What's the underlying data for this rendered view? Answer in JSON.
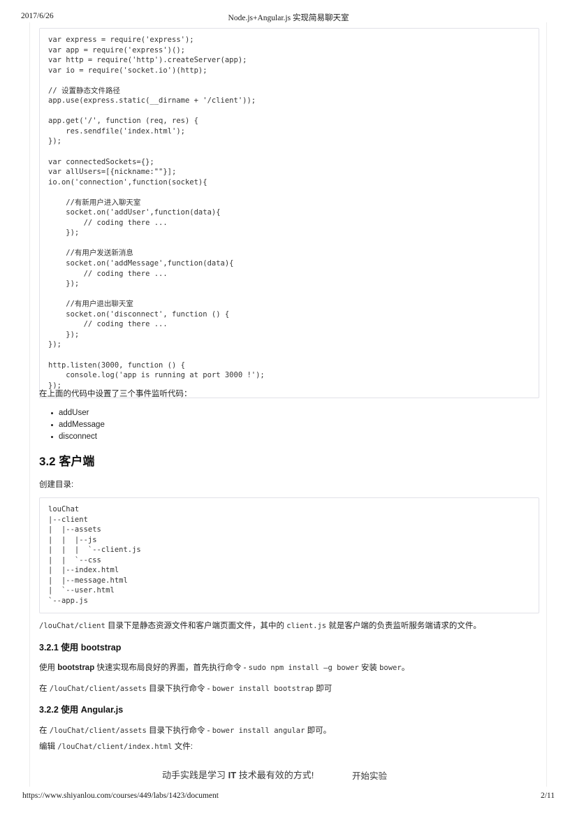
{
  "print_header": {
    "date": "2017/6/26",
    "title": "Node.js+Angular.js 实现简易聊天室"
  },
  "print_footer": {
    "url": "https://www.shiyanlou.com/courses/449/labs/1423/document",
    "page": "2/11"
  },
  "content": {
    "server_code": "var express = require('express');\nvar app = require('express')();\nvar http = require('http').createServer(app);\nvar io = require('socket.io')(http);\n\n// 设置静态文件路径\napp.use(express.static(__dirname + '/client'));\n\napp.get('/', function (req, res) {\n    res.sendfile('index.html');\n});\n\nvar connectedSockets={};\nvar allUsers=[{nickname:\"\"}];\nio.on('connection',function(socket){\n\n    //有新用户进入聊天室\n    socket.on('addUser',function(data){\n        // coding there ...\n    });\n\n    //有用户发送新消息\n    socket.on('addMessage',function(data){\n        // coding there ...\n    });\n\n    //有用户退出聊天室\n    socket.on('disconnect', function () {\n        // coding there ...\n    });\n});\n\nhttp.listen(3000, function () {\n    console.log('app is running at port 3000 !');\n});",
    "intro_line": "在上面的代码中设置了三个事件监听代码：",
    "event_list": [
      "addUser",
      "addMessage",
      "disconnect"
    ],
    "section_32_title": "3.2 客户端",
    "create_dir_label": "创建目录:",
    "tree_code": "louChat\n|--client\n|  |--assets\n|  |  |--js\n|  |  |  `--client.js\n|  |  `--css\n|  |--index.html\n|  |--message.html\n|  `--user.html\n`--app.js",
    "tree_desc": {
      "code1": "/louChat/client",
      "text1": " 目录下是静态资源文件和客户端页面文件，其中的 ",
      "code2": "client.js",
      "text2": " 就是客户端的负责监听服务端请求的文件。"
    },
    "section_321_title_prefix": "3.2.1 使用 ",
    "section_321_title_code": "bootstrap",
    "bootstrap_p1": {
      "text1": "使用 ",
      "bold1": "bootstrap",
      "text2": " 快速实现布局良好的界面，首先执行命令 - ",
      "code1": "sudo npm install –g bower",
      "text3": " 安装 ",
      "code2": "bower",
      "text4": "。"
    },
    "bootstrap_p2": {
      "text1": "在 ",
      "code1": "/louChat/client/assets",
      "text2": " 目录下执行命令 - ",
      "code2": "bower install bootstrap",
      "text3": " 即可"
    },
    "section_322_title_prefix": "3.2.2 使用 ",
    "section_322_title_code": "Angular.js",
    "angular_p1": {
      "text1": "在 ",
      "code1": "/louChat/client/assets",
      "text2": " 目录下执行命令 - ",
      "code2": "bower install angular",
      "text3": " 即可。"
    },
    "angular_p2": {
      "text1": "编辑 ",
      "code1": "/louChat/client/index.html",
      "text2": " 文件:"
    }
  },
  "promo": {
    "text_prefix": "动手实践是学习 ",
    "text_bold": "IT",
    "text_suffix": " 技术最有效的方式!",
    "button_label": "开始实验"
  }
}
